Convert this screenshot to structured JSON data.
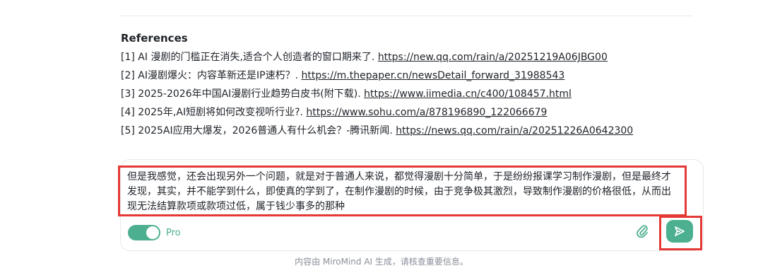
{
  "references": {
    "heading": "References",
    "items": [
      {
        "num": "[1]",
        "title": "AI 漫剧的门槛正在消失,适合个人创造者的窗口期来了.",
        "url": "https://new.qq.com/rain/a/20251219A06JBG00"
      },
      {
        "num": "[2]",
        "title": "AI漫剧爆火：内容革新还是IP速朽？.",
        "url": "https://m.thepaper.cn/newsDetail_forward_31988543"
      },
      {
        "num": "[3]",
        "title": "2025-2026年中国AI漫剧行业趋势白皮书(附下载).",
        "url": "https://www.iimedia.cn/c400/108457.html"
      },
      {
        "num": "[4]",
        "title": "2025年,AI短剧将如何改变视听行业?.",
        "url": "https://www.sohu.com/a/878196890_122066679"
      },
      {
        "num": "[5]",
        "title": "2025AI应用大爆发，2026普通人有什么机会？-腾讯新闻.",
        "url": "https://news.qq.com/rain/a/20251226A0642300"
      }
    ]
  },
  "composer": {
    "text": "但是我感觉，还会出现另外一个问题，就是对于普通人来说，都觉得漫剧十分简单，于是纷纷报课学习制作漫剧，但是最终才发现，其实，并不能学到什么，即使真的学到了，在制作漫剧的时候，由于竞争极其激烈，导致制作漫剧的价格很低，从而出现无法结算款项或款项过低，属于钱少事多的那种",
    "mode_label": "Pro",
    "mode_on": true,
    "attach_icon": "paperclip-icon",
    "send_icon": "send-icon"
  },
  "footer": {
    "disclaimer": "内容由 MiroMind AI 生成，请核查重要信息。"
  },
  "colors": {
    "accent": "#4caf8f",
    "highlight": "#e53935"
  }
}
